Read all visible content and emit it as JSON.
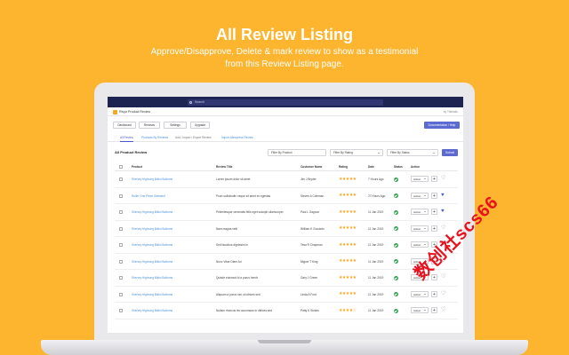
{
  "hero": {
    "title": "All Review Listing",
    "subtitle": "Approve/Disapprove, Delete & mark review to show as a testimonial from this Review Listing page."
  },
  "topbar": {
    "search_placeholder": "Search"
  },
  "app": {
    "name": "Rivyo Product Review",
    "by": "by Thimatic"
  },
  "nav": {
    "dashboard": "Dashboard",
    "reviews": "Reviews",
    "settings": "Settings",
    "upgrade": "Upgrade",
    "docs": "Documentation / Help"
  },
  "tabs": [
    "All Review",
    "Products By Reviews",
    "Add / Import / Export Review",
    "Import Aliexpress Review"
  ],
  "list": {
    "title": "All Product Review",
    "filter_product": "Filter By Product",
    "filter_rating": "Filter By Rating",
    "filter_status": "Filter By Status",
    "submit": "Submit"
  },
  "table": {
    "headers": [
      "Product",
      "Review Title",
      "Customer Name",
      "Rating",
      "Date",
      "Status",
      "Action"
    ],
    "action_label": "Action",
    "rows": [
      {
        "product": "Sherory Highrung Bikini Bottoms",
        "title": "Lorem ipsum dolor sit amet",
        "customer": "Jim J Bryder",
        "rating": 5,
        "date": "7 Hours Ago",
        "favorite": false
      },
      {
        "product": "Roller One Piece Swimsuit",
        "title": "Proin sollicitudin neque sit amet ex egestas",
        "customer": "Steven A Coleman",
        "rating": 5,
        "date": "27 Hours Ago",
        "favorite": true
      },
      {
        "product": "Sherory Highrung Bikini Bottoms",
        "title": "Pellentesque venenatis felis eget suscipit ullamcorper",
        "customer": "Paul L Gagnon",
        "rating": 5,
        "date": "11 Jan 2019",
        "favorite": true
      },
      {
        "product": "Sherory Highrung Bikini Bottoms",
        "title": "Nam magna velit",
        "customer": "William K Goodwin",
        "rating": 5,
        "date": "11 Jan 2019",
        "favorite": false
      },
      {
        "product": "Sherory Highrung Bikini Bottoms",
        "title": "Sed faucibus dignissim le",
        "customer": "Tesa R Chapman",
        "rating": 5,
        "date": "11 Jan 2019",
        "favorite": false
      },
      {
        "product": "Sherory Highrung Bikini Bottoms",
        "title": "Nunc Vitae Diam Ad",
        "customer": "Miguel T King",
        "rating": 5,
        "date": "11 Jan 2019",
        "favorite": false
      },
      {
        "product": "Sherory Highrung Bikini Bottoms",
        "title": "Quisde euismod id a purus hendr",
        "customer": "Gary J Green",
        "rating": 5,
        "date": "11 Jan 2019",
        "favorite": false
      },
      {
        "product": "Sherory Highrung Bikini Bottoms",
        "title": "Aliquam a purus nec ut ultrices sed",
        "customer": "Linda A Ford",
        "rating": 5,
        "date": "11 Jan 2019",
        "favorite": false
      },
      {
        "product": "Sherory Highrung Bikini Bottoms",
        "title": "Nullam rhoncus leo accumsan in ultrices sed",
        "customer": "Patty K Stokes",
        "rating": 4,
        "date": "11 Jan 2019",
        "favorite": false
      }
    ]
  },
  "watermark": "数创社scs66",
  "colors": {
    "background": "#fdb42e",
    "topbar": "#1e2452",
    "accent": "#5b6ad0",
    "star": "#f5a623",
    "status_ok": "#2ea44f",
    "link": "#4a90d9"
  }
}
